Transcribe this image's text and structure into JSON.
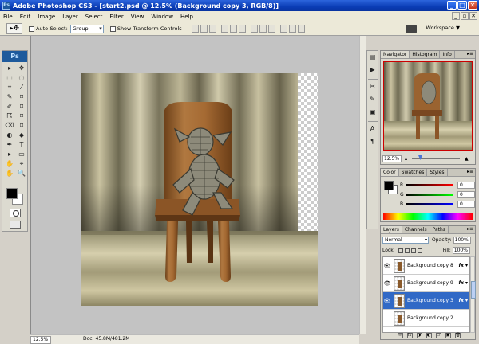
{
  "window": {
    "title": "Adobe Photoshop CS3 - [start2.psd @ 12.5% (Background copy 3, RGB/8)]",
    "app_icon": "Ps",
    "buttons": {
      "minimize": "_",
      "maximize": "□",
      "close": "✕"
    }
  },
  "menu": {
    "items": [
      "File",
      "Edit",
      "Image",
      "Layer",
      "Select",
      "Filter",
      "View",
      "Window",
      "Help"
    ],
    "doc_buttons": [
      "_",
      "▫",
      "✕"
    ]
  },
  "options": {
    "auto_select_label": "Auto-Select:",
    "auto_select_value": "Group",
    "show_transform_label": "Show Transform Controls",
    "workspace_label": "Workspace ▼"
  },
  "toolbox": {
    "logo": "Ps",
    "tools": [
      "▸",
      "✥",
      "⬚",
      "◌",
      "⌗",
      "⁄",
      "✎",
      "⌑",
      "✐",
      "⌑",
      "☈",
      "⌑",
      "⌫",
      "⌑",
      "◐",
      "◆",
      "✒",
      "T",
      "▸",
      "▭",
      "✋",
      "⌖",
      "✋",
      "🔍"
    ],
    "foreground": "#000000",
    "background": "#ffffff"
  },
  "document": {
    "zoom": "12.5%",
    "doc_size": "Doc: 45.8M/481.2M"
  },
  "panels": {
    "navigator": {
      "tabs": [
        "Navigator",
        "Histogram",
        "Info"
      ],
      "zoom": "12.5%"
    },
    "color": {
      "tabs": [
        "Color",
        "Swatches",
        "Styles"
      ],
      "channels": [
        {
          "label": "R",
          "value": "0",
          "color": "#c81e1e"
        },
        {
          "label": "G",
          "value": "0",
          "color": "#1e9a1e"
        },
        {
          "label": "B",
          "value": "0",
          "color": "#1e1ec8"
        }
      ]
    },
    "layers": {
      "tabs": [
        "Layers",
        "Channels",
        "Paths"
      ],
      "blend_mode": "Normal",
      "opacity_label": "Opacity:",
      "opacity_value": "100%",
      "lock_label": "Lock:",
      "fill_label": "Fill:",
      "fill_value": "100%",
      "items": [
        {
          "name": "Background copy 8",
          "fx": "fx",
          "selected": false,
          "visible": true
        },
        {
          "name": "Background copy 9",
          "fx": "fx",
          "selected": false,
          "visible": true
        },
        {
          "name": "Background copy 3",
          "fx": "fx",
          "selected": true,
          "visible": true
        },
        {
          "name": "Background copy 2",
          "fx": "",
          "selected": false,
          "visible": false
        }
      ],
      "footer_icons": [
        "∞",
        "fx",
        "◑",
        "◐",
        "▭",
        "▣",
        "🗑"
      ]
    }
  }
}
